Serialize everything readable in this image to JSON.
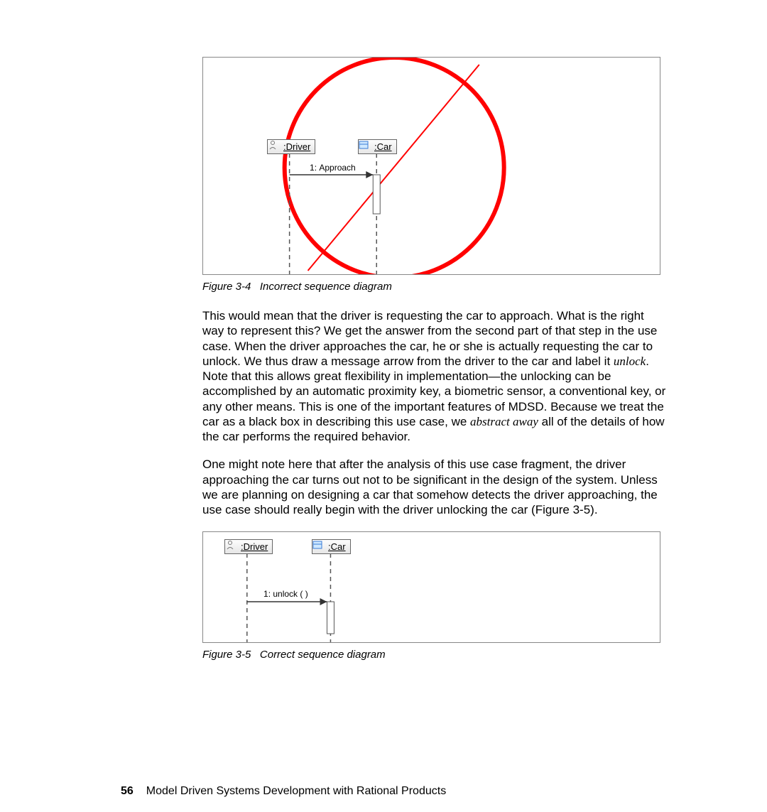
{
  "figure1": {
    "caption_prefix": "Figure 3-4",
    "caption_text": "Incorrect sequence diagram",
    "lifelines": [
      {
        "name": ":Driver",
        "icon": "actor"
      },
      {
        "name": ":Car",
        "icon": "class"
      }
    ],
    "messages": [
      {
        "seq": "1",
        "label": "Approach"
      }
    ]
  },
  "paragraph1": {
    "pre_italic1": "This would mean that the driver is requesting the car to approach. What is the right way to represent this? We get the answer from the second part of that step in the use case. When the driver approaches the car, he or she is actually requesting the car to unlock. We thus draw a message arrow from the driver to the car and label it ",
    "italic1": "unlock",
    "mid": ". Note that this allows great flexibility in implementation—the unlocking can be accomplished by an automatic proximity key, a biometric sensor, a conventional key, or any other means. This is one of the important features of MDSD. Because we treat the car as a black box in describing this use case, we ",
    "italic2": "abstract away",
    "post": " all of the details of how the car performs the required behavior."
  },
  "paragraph2": "One might note here that after the analysis of this use case fragment, the driver approaching the car turns out not to be significant in the design of the system. Unless we are planning on designing a car that somehow detects the driver approaching, the use case should really begin with the driver unlocking the car (Figure 3-5).",
  "figure2": {
    "caption_prefix": "Figure 3-5",
    "caption_text": "Correct sequence diagram",
    "lifelines": [
      {
        "name": ":Driver",
        "icon": "actor"
      },
      {
        "name": ":Car",
        "icon": "class"
      }
    ],
    "messages": [
      {
        "seq": "1",
        "label": "unlock ( )"
      }
    ]
  },
  "footer": {
    "page_number": "56",
    "book_title": "Model Driven Systems Development with Rational Products"
  }
}
